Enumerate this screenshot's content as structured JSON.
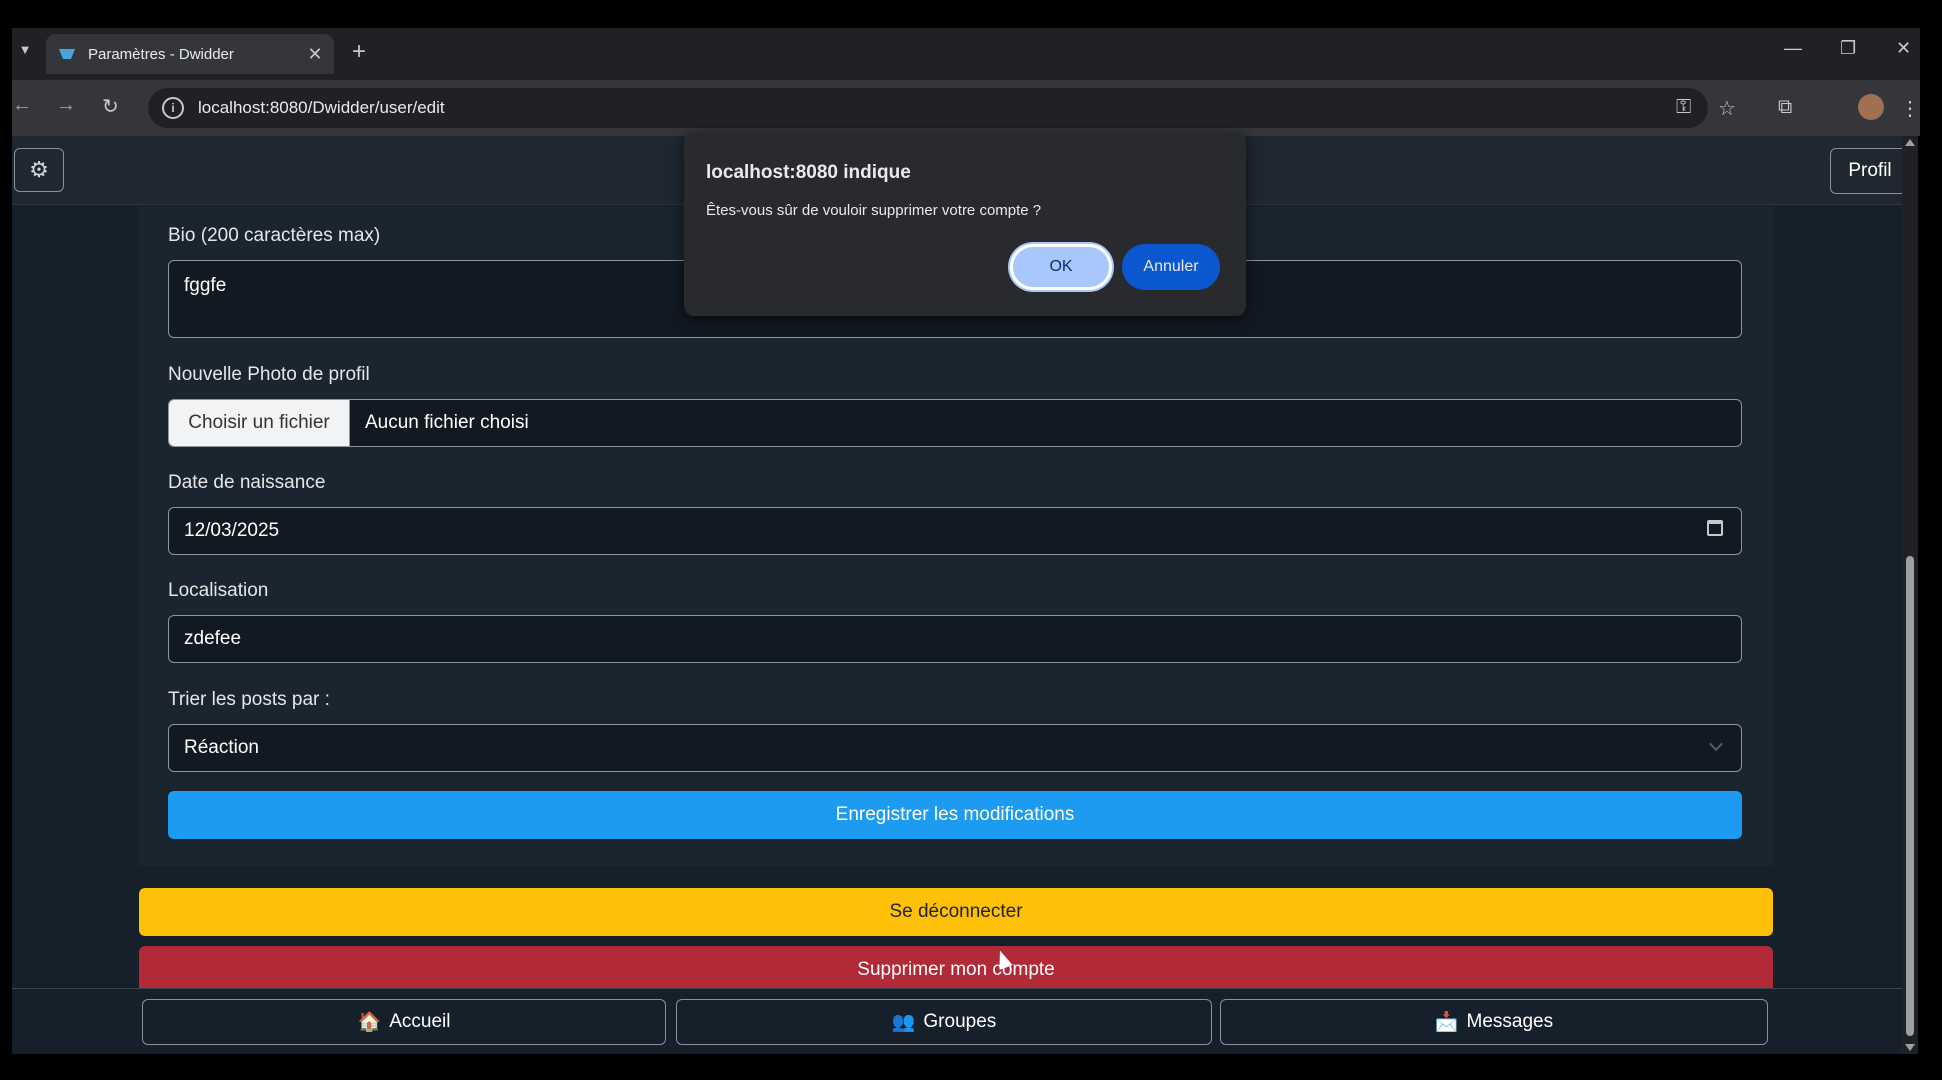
{
  "browser": {
    "tab_title": "Paramètres - Dwidder",
    "tab_close": "✕",
    "new_tab": "+",
    "url": "localhost:8080/Dwidder/user/edit"
  },
  "topnav": {
    "settings_icon": "gear-icon",
    "profile_label": "Profil"
  },
  "form": {
    "bio_label": "Bio (200 caractères max)",
    "bio_value": "fggfe",
    "photo_label": "Nouvelle Photo de profil",
    "photo_button": "Choisir un fichier",
    "photo_status": "Aucun fichier choisi",
    "birthdate_label": "Date de naissance",
    "birthdate_value": "12/03/2025",
    "location_label": "Localisation",
    "location_value": "zdefee",
    "sort_label": "Trier les posts par :",
    "sort_value": "Réaction",
    "save_button": "Enregistrer les modifications"
  },
  "actions": {
    "logout_button": "Se déconnecter",
    "delete_button": "Supprimer mon compte"
  },
  "footer": {
    "home": "Accueil",
    "groups": "Groupes",
    "messages": "Messages"
  },
  "dialog": {
    "title": "localhost:8080 indique",
    "message": "Êtes-vous sûr de vouloir supprimer votre compte ?",
    "ok": "OK",
    "cancel": "Annuler"
  },
  "colors": {
    "save": "#1d9bf0",
    "logout": "#ffc107",
    "delete": "#b02a37",
    "page_bg": "#15202b"
  }
}
